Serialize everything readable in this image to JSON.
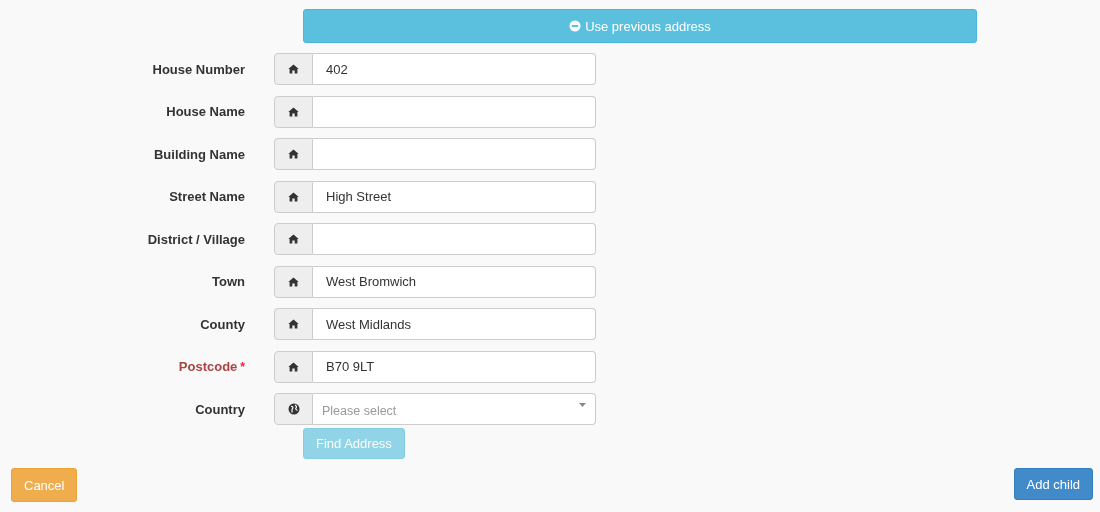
{
  "previous_address_button": {
    "label": "Use previous address"
  },
  "fields": [
    {
      "label": "House Number",
      "kind": "text",
      "value": "402"
    },
    {
      "label": "House Name",
      "kind": "text"
    },
    {
      "label": "Building Name",
      "kind": "text"
    },
    {
      "label": "Street Name",
      "kind": "text",
      "value": "High Street"
    },
    {
      "label": "District / Village",
      "kind": "text"
    },
    {
      "label": "Town",
      "kind": "text",
      "value": "West Bromwich"
    },
    {
      "label": "County",
      "kind": "text",
      "value": "West Midlands"
    },
    {
      "label": "Postcode",
      "kind": "text",
      "value": "B70 9LT",
      "required_mark": "*"
    },
    {
      "label": "Country",
      "kind": "select",
      "placeholder": "Please select"
    }
  ],
  "find_address_button": {
    "label": "Find Address",
    "disabled": true
  },
  "cancel_button": {
    "label": "Cancel"
  },
  "add_child_button": {
    "label": "Add child"
  }
}
